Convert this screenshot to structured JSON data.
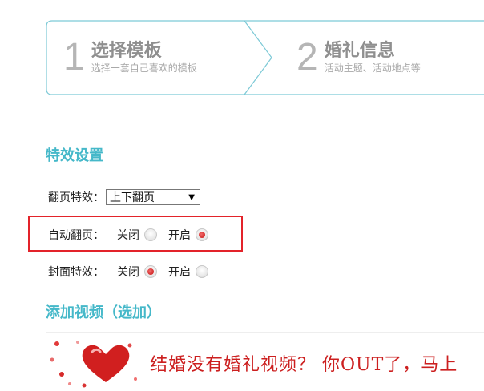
{
  "steps": [
    {
      "num": "1",
      "title": "选择模板",
      "sub": "选择一套自己喜欢的模板"
    },
    {
      "num": "2",
      "title": "婚礼信息",
      "sub": "活动主题、活动地点等"
    }
  ],
  "effects": {
    "title": "特效设置",
    "page_turn": {
      "label": "翻页特效：",
      "selected": "上下翻页"
    },
    "auto_page": {
      "label": "自动翻页：",
      "off_label": "关闭",
      "on_label": "开启",
      "value": "on"
    },
    "cover": {
      "label": "封面特效：",
      "off_label": "关闭",
      "on_label": "开启",
      "value": "off"
    }
  },
  "video": {
    "title": "添加视频（选加）",
    "banner_text": "结婚没有婚礼视频？ 你OUT了，马上"
  },
  "colors": {
    "accent": "#45b8c9",
    "highlight": "#e3232a",
    "radio_on": "#d42b2b"
  }
}
